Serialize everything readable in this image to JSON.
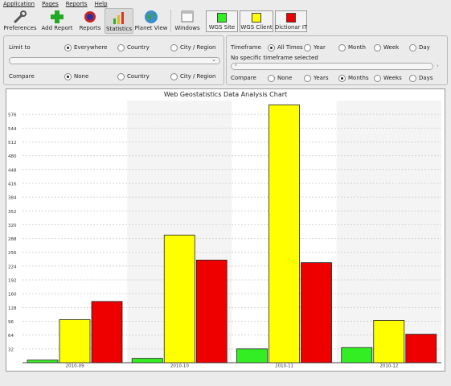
{
  "menu": [
    "Application",
    "Pages",
    "Reports",
    "Help"
  ],
  "toolbar": {
    "preferences": "Preferences",
    "add_report": "Add Report",
    "reports": "Reports",
    "statistics": "Statistics",
    "planet_view": "Planet View",
    "windows": "Windows",
    "legend": [
      {
        "label": "WGS Site",
        "color": "#33ee22"
      },
      {
        "label": "WGS Client",
        "color": "#ffff00"
      },
      {
        "label": "Dictionar IT",
        "color": "#ee0000"
      }
    ]
  },
  "filters": {
    "limit_to_label": "Limit to",
    "limit_options": [
      "Everywhere",
      "Country",
      "City / Region"
    ],
    "limit_selected": "Everywhere",
    "compare_label": "Compare",
    "compare_options": [
      "None",
      "Country",
      "City / Region"
    ],
    "compare_selected": "None"
  },
  "timeframe": {
    "label": "Timeframe",
    "options": [
      "All Times",
      "Year",
      "Month",
      "Week",
      "Day"
    ],
    "selected": "All Times",
    "status": "No specific timeframe selected",
    "compare_label": "Compare",
    "compare_options": [
      "None",
      "Years",
      "Months",
      "Weeks",
      "Days"
    ],
    "compare_selected": "Months"
  },
  "chart_data": {
    "type": "bar",
    "title": "Web Geostatistics Data Analysis Chart",
    "categories": [
      "2010-09",
      "2010-10",
      "2010-11",
      "2010-12"
    ],
    "series": [
      {
        "name": "WGS Site",
        "color": "#33ee22",
        "values": [
          6,
          10,
          32,
          35
        ]
      },
      {
        "name": "WGS Client",
        "color": "#ffff00",
        "values": [
          100,
          296,
          598,
          98
        ]
      },
      {
        "name": "Dictionar IT",
        "color": "#ee0000",
        "values": [
          142,
          238,
          232,
          66
        ]
      }
    ],
    "yticks": [
      32,
      64,
      96,
      128,
      160,
      192,
      224,
      256,
      288,
      320,
      352,
      384,
      416,
      448,
      480,
      512,
      544,
      576
    ],
    "ylim": [
      0,
      608
    ],
    "grid": true
  }
}
